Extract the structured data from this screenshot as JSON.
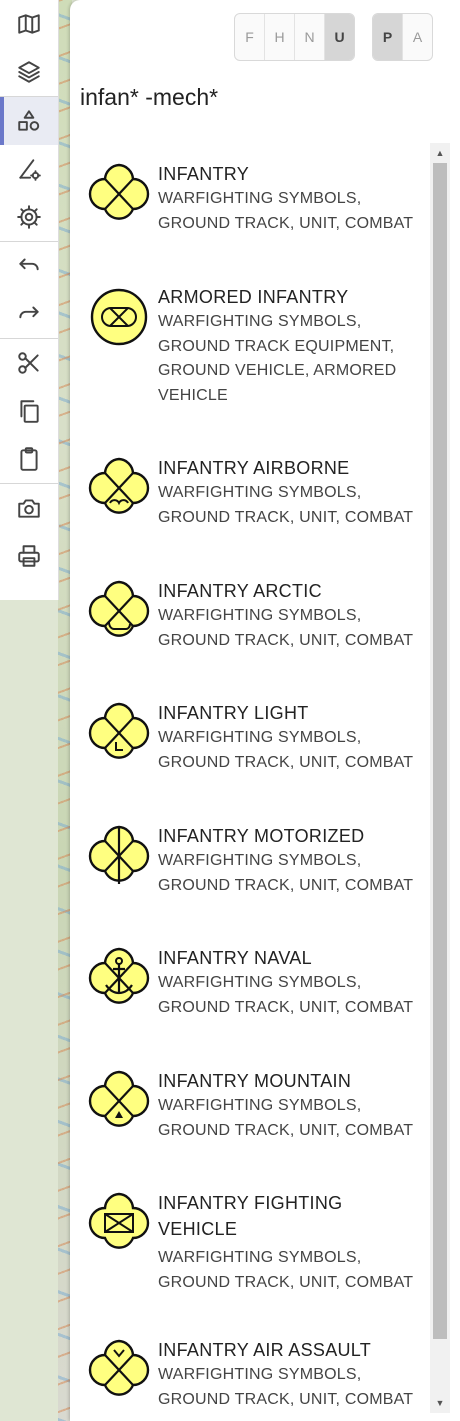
{
  "toolbar": {
    "tools": [
      {
        "name": "map-icon"
      },
      {
        "name": "layers-icon"
      },
      {
        "name": "symbols-icon",
        "active": true
      },
      {
        "name": "draw-settings-icon"
      },
      {
        "name": "settings-gear-icon"
      },
      {
        "name": "undo-icon"
      },
      {
        "name": "redo-icon"
      },
      {
        "name": "cut-scissors-icon"
      },
      {
        "name": "copy-icon"
      },
      {
        "name": "paste-clipboard-icon"
      },
      {
        "name": "camera-icon"
      },
      {
        "name": "print-icon"
      }
    ]
  },
  "filters": {
    "identity": [
      "F",
      "H",
      "N",
      "U"
    ],
    "identity_selected": "U",
    "status": [
      "P",
      "A"
    ],
    "status_selected": "P"
  },
  "search": {
    "query": "infan* -mech*"
  },
  "colors": {
    "symbol_fill": "#ffff80",
    "accent": "#6b78c9"
  },
  "results": [
    {
      "name": "INFANTRY",
      "category": [
        "WARFIGHTING SYMBOLS,",
        "GROUND TRACK, UNIT, COMBAT"
      ],
      "icon": "infantry-symbol-icon"
    },
    {
      "name": "ARMORED INFANTRY",
      "category": [
        "WARFIGHTING SYMBOLS,",
        "GROUND TRACK EQUIPMENT,",
        "GROUND VEHICLE, ARMORED",
        "VEHICLE"
      ],
      "icon": "armored-infantry-symbol-icon"
    },
    {
      "name": "INFANTRY AIRBORNE",
      "category": [
        "WARFIGHTING SYMBOLS,",
        "GROUND TRACK, UNIT, COMBAT"
      ],
      "icon": "infantry-airborne-symbol-icon"
    },
    {
      "name": "INFANTRY ARCTIC",
      "category": [
        "WARFIGHTING SYMBOLS,",
        "GROUND TRACK, UNIT, COMBAT"
      ],
      "icon": "infantry-arctic-symbol-icon"
    },
    {
      "name": "INFANTRY LIGHT",
      "category": [
        "WARFIGHTING SYMBOLS,",
        "GROUND TRACK, UNIT, COMBAT"
      ],
      "icon": "infantry-light-symbol-icon"
    },
    {
      "name": "INFANTRY MOTORIZED",
      "category": [
        "WARFIGHTING SYMBOLS,",
        "GROUND TRACK, UNIT, COMBAT"
      ],
      "icon": "infantry-motorized-symbol-icon"
    },
    {
      "name": "INFANTRY NAVAL",
      "category": [
        "WARFIGHTING SYMBOLS,",
        "GROUND TRACK, UNIT, COMBAT"
      ],
      "icon": "infantry-naval-symbol-icon"
    },
    {
      "name": "INFANTRY MOUNTAIN",
      "category": [
        "WARFIGHTING SYMBOLS,",
        "GROUND TRACK, UNIT, COMBAT"
      ],
      "icon": "infantry-mountain-symbol-icon"
    },
    {
      "name": [
        "INFANTRY FIGHTING",
        "VEHICLE"
      ],
      "category": [
        "WARFIGHTING SYMBOLS,",
        "GROUND TRACK, UNIT, COMBAT"
      ],
      "icon": "infantry-fighting-vehicle-symbol-icon"
    },
    {
      "name": "INFANTRY AIR ASSAULT",
      "category": [
        "WARFIGHTING SYMBOLS,",
        "GROUND TRACK, UNIT, COMBAT"
      ],
      "icon": "infantry-air-assault-symbol-icon"
    }
  ]
}
